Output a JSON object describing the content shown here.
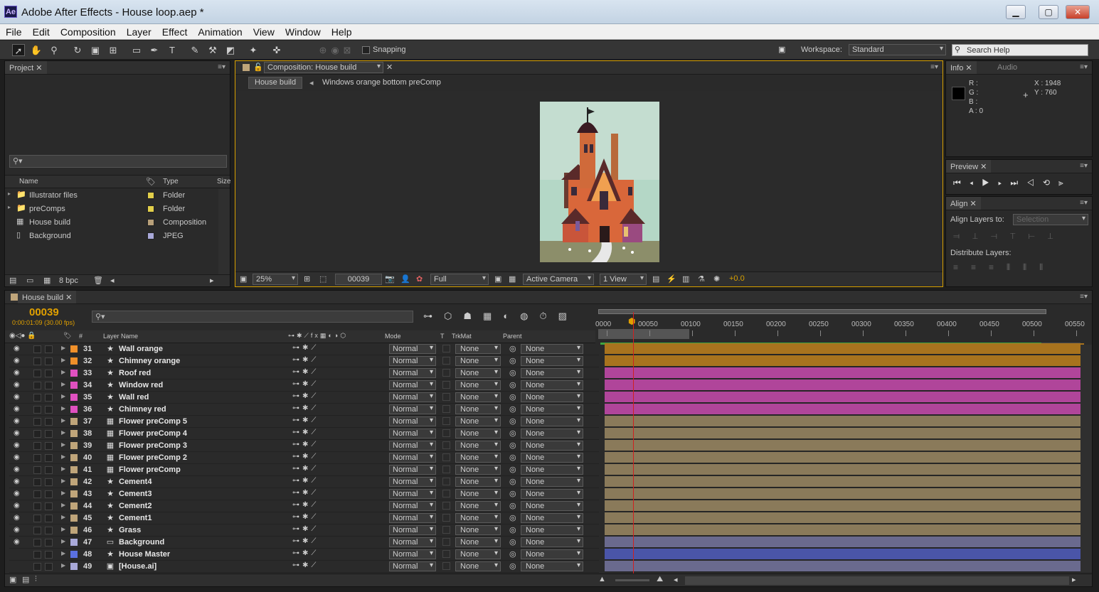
{
  "window": {
    "title": "Adobe After Effects - House loop.aep *",
    "logo": "Ae",
    "min": "▁",
    "max": "▢",
    "close": "✕"
  },
  "menu": [
    "File",
    "Edit",
    "Composition",
    "Layer",
    "Effect",
    "Animation",
    "View",
    "Window",
    "Help"
  ],
  "toolbar": {
    "snapping": "Snapping",
    "workspace_label": "Workspace:",
    "workspace_value": "Standard",
    "search_placeholder": "Search Help"
  },
  "project": {
    "tab": "Project",
    "search_placeholder": "",
    "columns": {
      "name": "Name",
      "type": "Type",
      "size": "Size"
    },
    "items": [
      {
        "name": "Illustrator files",
        "type": "Folder",
        "color": "#e2cf4a",
        "icon": "folder-icon"
      },
      {
        "name": "preComps",
        "type": "Folder",
        "color": "#e2cf4a",
        "icon": "folder-icon"
      },
      {
        "name": "House build",
        "type": "Composition",
        "color": "#b8a07a",
        "icon": "composition-icon"
      },
      {
        "name": "Background",
        "type": "JPEG",
        "color": "#a9a9d9",
        "icon": "image-icon"
      }
    ],
    "bpc": "8 bpc"
  },
  "composition": {
    "tab": "Composition: House build",
    "breadcrumb_active": "House build",
    "breadcrumb_next": "Windows orange  bottom preComp",
    "zoom": "25%",
    "timecode": "00039",
    "resolution": "Full",
    "camera": "Active Camera",
    "view": "1 View",
    "exposure": "+0.0"
  },
  "info": {
    "tab": "Info",
    "tab2": "Audio",
    "r": "R :",
    "g": "G :",
    "b": "B :",
    "a": "A : 0",
    "x": "X : 1948",
    "y": "Y : 760"
  },
  "preview": {
    "tab": "Preview"
  },
  "align": {
    "tab": "Align",
    "layers_to_label": "Align Layers to:",
    "layers_to_value": "Selection",
    "distribute_label": "Distribute Layers:"
  },
  "timeline": {
    "tab": "House build",
    "timecode": "00039",
    "subtime": "0:00:01:09 (30.00 fps)",
    "headers": {
      "num": "#",
      "layer_name": "Layer Name",
      "mode": "Mode",
      "t": "T",
      "trkmat": "TrkMat",
      "parent": "Parent"
    },
    "ruler": [
      "0000",
      "00050",
      "00100",
      "00150",
      "00200",
      "00250",
      "00300",
      "00350",
      "00400",
      "00450",
      "00500",
      "00550"
    ],
    "layers": [
      {
        "num": "31",
        "name": "Wall orange",
        "label": "#f0902a",
        "icon": "★",
        "mode": "Normal",
        "trk": "None",
        "parent": "None",
        "bar": "#a8731e"
      },
      {
        "num": "32",
        "name": "Chimney orange",
        "label": "#f0902a",
        "icon": "★",
        "mode": "Normal",
        "trk": "None",
        "parent": "None",
        "bar": "#a8731e"
      },
      {
        "num": "33",
        "name": "Roof red",
        "label": "#e050c0",
        "icon": "★",
        "mode": "Normal",
        "trk": "None",
        "parent": "None",
        "bar": "#b0459a"
      },
      {
        "num": "34",
        "name": "Window red",
        "label": "#e050c0",
        "icon": "★",
        "mode": "Normal",
        "trk": "None",
        "parent": "None",
        "bar": "#b0459a"
      },
      {
        "num": "35",
        "name": "Wall red",
        "label": "#e050c0",
        "icon": "★",
        "mode": "Normal",
        "trk": "None",
        "parent": "None",
        "bar": "#b0459a"
      },
      {
        "num": "36",
        "name": "Chimney red",
        "label": "#e050c0",
        "icon": "★",
        "mode": "Normal",
        "trk": "None",
        "parent": "None",
        "bar": "#b0459a"
      },
      {
        "num": "37",
        "name": "Flower preComp 5",
        "label": "#bfa57a",
        "icon": "▦",
        "mode": "Normal",
        "trk": "None",
        "parent": "None",
        "bar": "#8a7a5a"
      },
      {
        "num": "38",
        "name": "Flower preComp 4",
        "label": "#bfa57a",
        "icon": "▦",
        "mode": "Normal",
        "trk": "None",
        "parent": "None",
        "bar": "#8a7a5a"
      },
      {
        "num": "39",
        "name": "Flower preComp 3",
        "label": "#bfa57a",
        "icon": "▦",
        "mode": "Normal",
        "trk": "None",
        "parent": "None",
        "bar": "#8a7a5a"
      },
      {
        "num": "40",
        "name": "Flower preComp 2",
        "label": "#bfa57a",
        "icon": "▦",
        "mode": "Normal",
        "trk": "None",
        "parent": "None",
        "bar": "#8a7a5a"
      },
      {
        "num": "41",
        "name": "Flower preComp",
        "label": "#bfa57a",
        "icon": "▦",
        "mode": "Normal",
        "trk": "None",
        "parent": "None",
        "bar": "#8a7a5a"
      },
      {
        "num": "42",
        "name": "Cement4",
        "label": "#bfa57a",
        "icon": "★",
        "mode": "Normal",
        "trk": "None",
        "parent": "None",
        "bar": "#8a7a5a"
      },
      {
        "num": "43",
        "name": "Cement3",
        "label": "#bfa57a",
        "icon": "★",
        "mode": "Normal",
        "trk": "None",
        "parent": "None",
        "bar": "#8a7a5a"
      },
      {
        "num": "44",
        "name": "Cement2",
        "label": "#bfa57a",
        "icon": "★",
        "mode": "Normal",
        "trk": "None",
        "parent": "None",
        "bar": "#8a7a5a"
      },
      {
        "num": "45",
        "name": "Cement1",
        "label": "#bfa57a",
        "icon": "★",
        "mode": "Normal",
        "trk": "None",
        "parent": "None",
        "bar": "#8a7a5a"
      },
      {
        "num": "46",
        "name": "Grass",
        "label": "#bfa57a",
        "icon": "★",
        "mode": "Normal",
        "trk": "None",
        "parent": "None",
        "bar": "#8a7a5a"
      },
      {
        "num": "47",
        "name": "Background",
        "label": "#a9a9d9",
        "icon": "▭",
        "mode": "Normal",
        "trk": "None",
        "parent": "None",
        "bar": "#6a6a8e"
      },
      {
        "num": "48",
        "name": "House Master",
        "label": "#5a70e0",
        "icon": "★",
        "mode": "Normal",
        "trk": "None",
        "parent": "None",
        "bar": "#4a55a8"
      },
      {
        "num": "49",
        "name": "[House.ai]",
        "label": "#a9a9d9",
        "icon": "▣",
        "mode": "Normal",
        "trk": "None",
        "parent": "None",
        "bar": "#6a6a8e"
      }
    ]
  }
}
